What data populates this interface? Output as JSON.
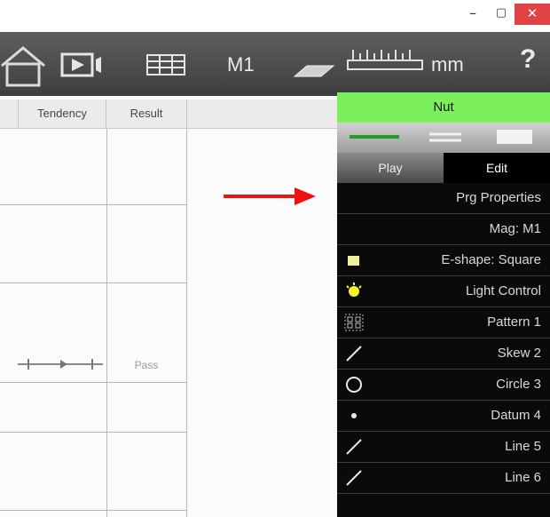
{
  "window": {
    "min_glyph": "–",
    "max_glyph": "▢",
    "close_glyph": "✕",
    "close_color": "#e04343"
  },
  "toolbar": {
    "home_icon": "home-icon",
    "video_icon": "video-camera-icon",
    "table_icon": "table-icon",
    "magnification": "M1",
    "stage_icon": "stage-plate-icon",
    "ruler_icon": "ruler-icon",
    "units": "mm",
    "help": "?"
  },
  "table": {
    "columns": [
      "Tendency",
      "Result"
    ],
    "row4_result": "Pass"
  },
  "panel": {
    "program_name": "Nut",
    "program_name_color": "#7cf05a",
    "tabs": {
      "play": "Play",
      "edit": "Edit"
    },
    "items": [
      {
        "label": "Prg Properties",
        "icon": ""
      },
      {
        "label": "Mag: M1",
        "icon": ""
      },
      {
        "label": "E-shape: Square",
        "icon": "square-shape-icon"
      },
      {
        "label": "Light Control",
        "icon": "light-bulb-icon"
      },
      {
        "label": "Pattern 1",
        "icon": "pattern-grid-icon"
      },
      {
        "label": "Skew 2",
        "icon": "line-diagonal-icon"
      },
      {
        "label": "Circle 3",
        "icon": "circle-icon"
      },
      {
        "label": "Datum 4",
        "icon": "point-icon"
      },
      {
        "label": "Line 5",
        "icon": "line-diagonal-icon"
      },
      {
        "label": "Line 6",
        "icon": "line-diagonal-icon"
      }
    ]
  },
  "annotation": {
    "arrow_color": "#ee1111"
  }
}
